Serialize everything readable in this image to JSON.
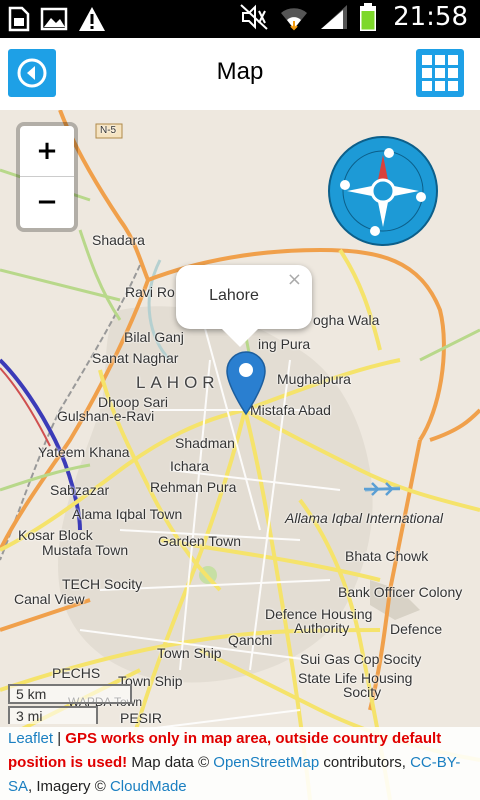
{
  "status_bar": {
    "time": "21:58",
    "left_icons": [
      "sim-card-icon",
      "image-icon",
      "warning-icon"
    ],
    "right_icons": [
      "mute-icon",
      "wifi-icon",
      "signal-icon",
      "battery-icon"
    ],
    "battery_color": "#7dd82a"
  },
  "header": {
    "title": "Map",
    "accent_color": "#1ea0e6"
  },
  "map": {
    "zoom_in_label": "+",
    "zoom_out_label": "−",
    "popup_text": "Lahore",
    "popup_close": "×",
    "road_shield": "N-5",
    "places": {
      "shadara": "Shadara",
      "ravi_road": "Ravi Ro",
      "bilal_ganj": "Bilal Ganj",
      "sanat_naghar": "Sanat Naghar",
      "lahore": "LAHOR",
      "dhoop_sari": "Dhoop Sari",
      "gulshan_e_ravi": "Gulshan-e-Ravi",
      "yateem_khana": "Yateem Khana",
      "sabzazar": "Sabzazar",
      "alama_iqbal_town": "Alama Iqbal Town",
      "kosar_block": "Kosar Block",
      "mustafa_town": "Mustafa Town",
      "tech_socity": "TECH Socity",
      "canal_view": "Canal View",
      "shadman": "Shadman",
      "ichara": "Ichara",
      "rehman_pura": "Rehman Pura",
      "garden_town": "Garden Town",
      "mughalpura": "Mughalpura",
      "mistafa_abad": "Mistafa Abad",
      "baghbanpura": "ing Pura",
      "fatehgarh": "ogha Wala",
      "allama_iqbal_intl": "Allama Iqbal International",
      "bhata_chowk": "Bhata Chowk",
      "bank_officer_colony": "Bank Officer Colony",
      "defence_housing": "Defence Housing",
      "authority": "Authority",
      "defence": "Defence",
      "qanchi": "Qanchi",
      "town_ship": "Town Ship",
      "town_ship_2": "Town Ship",
      "pechs": "PECHS",
      "wapda_town": "WAPDA Town",
      "pesir": "PESIR",
      "sui_gas": "Sui Gas Cop Socity",
      "state_life": "State Life Housing",
      "socity": "Socity"
    },
    "scale": {
      "km": "5 km",
      "mi": "3 mi"
    }
  },
  "attribution": {
    "leaflet": "Leaflet",
    "separator": " | ",
    "warning": "GPS works only in map area, outside country default position is used!",
    "map_data": " Map data © ",
    "osm": "OpenStreetMap",
    "contributors": " contributors, ",
    "license": "CC-BY-SA",
    "imagery": ", Imagery © ",
    "cloudmade": "CloudMade"
  }
}
